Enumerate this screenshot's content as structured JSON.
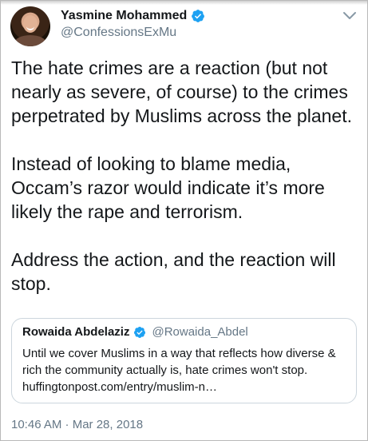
{
  "author": {
    "name": "Yasmine Mohammed",
    "handle": "@ConfessionsExMu",
    "verified_icon": "verified-badge-icon",
    "avatar_icon": "profile-avatar"
  },
  "menu_icon": "chevron-down-icon",
  "tweet": {
    "paragraphs": [
      "The hate crimes are a reaction (but not\nnearly as severe, of course) to the crimes\nperpetrated by Muslims across the planet.",
      "Instead of looking to blame media,\nOccam’s razor would indicate it’s more\nlikely the rape and terrorism.",
      "Address the action, and the reaction will\nstop."
    ]
  },
  "quote": {
    "name": "Rowaida Abdelaziz",
    "handle": "@Rowaida_Abdel",
    "lines": [
      "Until we cover Muslims in a way that reflects how diverse &",
      "rich the community actually is, hate crimes won't stop.",
      "huffingtonpost.com/entry/muslim-n…"
    ]
  },
  "timestamp": "10:46 AM · Mar 28, 2018",
  "colors": {
    "text": "#14171a",
    "secondary": "#657786",
    "verified": "#1da1f2",
    "border": "#ccd6dd"
  }
}
